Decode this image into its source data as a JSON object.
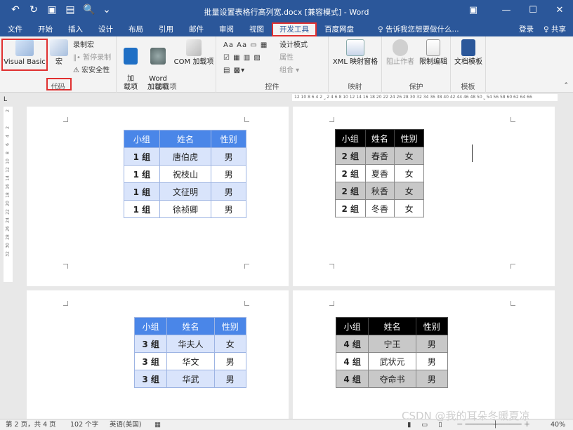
{
  "title_bar": {
    "doc_title": "批量设置表格行高列宽.docx [兼容模式] - Word",
    "ribbon_options": "▣",
    "minimize": "—",
    "restore": "☐",
    "close": "✕"
  },
  "qat": {
    "undo": "↶",
    "redo": "↻",
    "save": "▣",
    "print": "▤",
    "preview": "🔍",
    "customize": "⌄"
  },
  "tabs": [
    "文件",
    "开始",
    "插入",
    "设计",
    "布局",
    "引用",
    "邮件",
    "审阅",
    "视图",
    "开发工具",
    "百度网盘"
  ],
  "active_tab": "开发工具",
  "tell_me": "♀ 告诉我您想要做什么...",
  "login": "登录",
  "share": "♀ 共享",
  "ribbon": {
    "code": {
      "visual_basic": "Visual Basic",
      "macro": "宏",
      "record_macro": "录制宏",
      "pause_record": "‖• 暂停录制",
      "macro_security": "⚠ 宏安全性",
      "name": "代码"
    },
    "addins": {
      "addin": "加\n载项",
      "word_addin": "Word\n加载项",
      "com_addin": "COM 加载项",
      "name": "加载项"
    },
    "controls": {
      "design_mode": "设计模式",
      "properties": "属性",
      "group": "组合 ▾",
      "name": "控件"
    },
    "mapping": {
      "xml_pane": "XML 映射窗格",
      "name": "映射"
    },
    "protect": {
      "block_authors": "阻止作者",
      "restrict_editing": "限制编辑",
      "name": "保护"
    },
    "templates": {
      "doc_template": "文档模板",
      "name": "模板"
    }
  },
  "ruler_text": "12 10 8 6 4 2 ⎵ 2 4 6 8 10 12 14 16 18 20 22 24 26 28 30 32 34 36 38 40 42 44 46 48 50 ⎵ 54 56 58 60 62 64 66",
  "vruler_marks": [
    "2",
    "2",
    "4",
    "6",
    "8",
    "10",
    "12",
    "14",
    "16",
    "18",
    "20",
    "22",
    "24",
    "26",
    "28",
    "30",
    "32"
  ],
  "tables": {
    "headers": [
      "小组",
      "姓名",
      "性别"
    ],
    "t1": [
      [
        "1 组",
        "唐伯虎",
        "男"
      ],
      [
        "1 组",
        "祝枝山",
        "男"
      ],
      [
        "1 组",
        "文征明",
        "男"
      ],
      [
        "1 组",
        "徐祯卿",
        "男"
      ]
    ],
    "t2": [
      [
        "2 组",
        "春香",
        "女"
      ],
      [
        "2 组",
        "夏香",
        "女"
      ],
      [
        "2 组",
        "秋香",
        "女"
      ],
      [
        "2 组",
        "冬香",
        "女"
      ]
    ],
    "t3": [
      [
        "3 组",
        "华夫人",
        "女"
      ],
      [
        "3 组",
        "华文",
        "男"
      ],
      [
        "3 组",
        "华武",
        "男"
      ]
    ],
    "t4": [
      [
        "4 组",
        "宁王",
        "男"
      ],
      [
        "4 组",
        "武状元",
        "男"
      ],
      [
        "4 组",
        "夺命书",
        "男"
      ]
    ]
  },
  "status": {
    "page": "第 2 页，共 4 页",
    "words": "102 个字",
    "lang": "英语(美国)",
    "zoom": "40%"
  },
  "watermark": "CSDN @我的耳朵冬暖夏凉",
  "colors": {
    "brand": "#2b579a",
    "highlight": "#e03030",
    "table_blue": "#4a86e8",
    "table_dark": "#000000"
  }
}
